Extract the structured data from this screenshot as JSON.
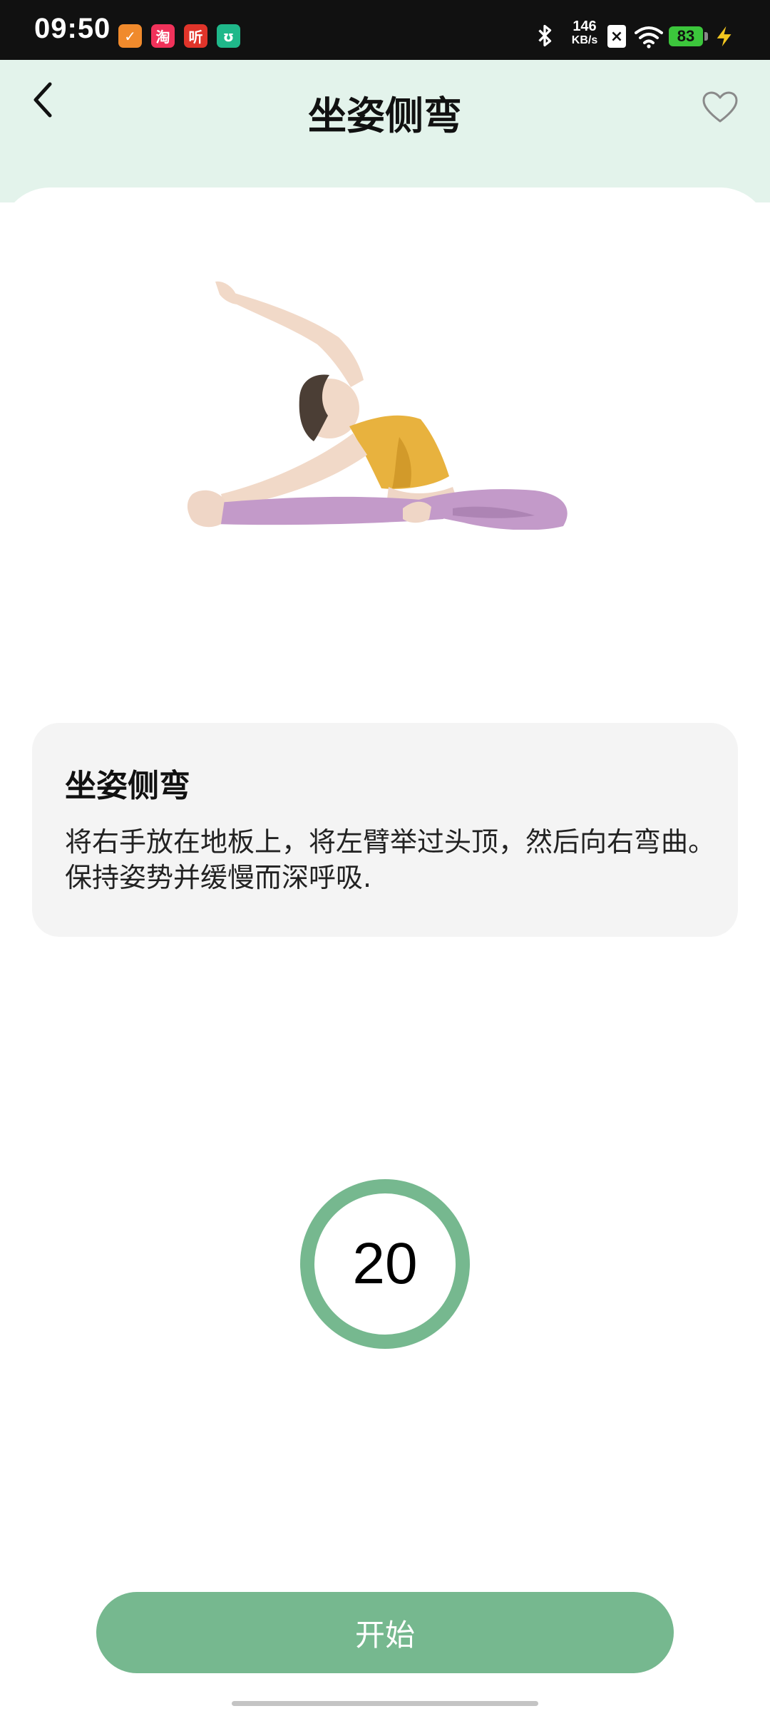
{
  "status_bar": {
    "time": "09:50",
    "notification_icons": [
      {
        "name": "taobao-flash-app-icon",
        "glyph": "✓",
        "color": "#f08a2c"
      },
      {
        "name": "taobao-app-icon",
        "glyph": "淘",
        "color": "#f0325a"
      },
      {
        "name": "listen-app-icon",
        "glyph": "听",
        "color": "#e0342a"
      },
      {
        "name": "mi-home-app-icon",
        "glyph": "ʊ",
        "color": "#1fb88a"
      }
    ],
    "net_speed_value": "146",
    "net_speed_unit": "KB/s",
    "battery_level": "83"
  },
  "header": {
    "title": "坐姿侧弯"
  },
  "exercise": {
    "title": "坐姿侧弯",
    "description": "将右手放在地板上，将左臂举过头顶，然后向右弯曲。 保持姿势并缓慢而深呼吸."
  },
  "timer": {
    "seconds": "20"
  },
  "actions": {
    "start_label": "开始"
  },
  "colors": {
    "header_bg": "#e3f3eb",
    "accent_green": "#76b88f",
    "card_bg": "#f4f4f4"
  }
}
